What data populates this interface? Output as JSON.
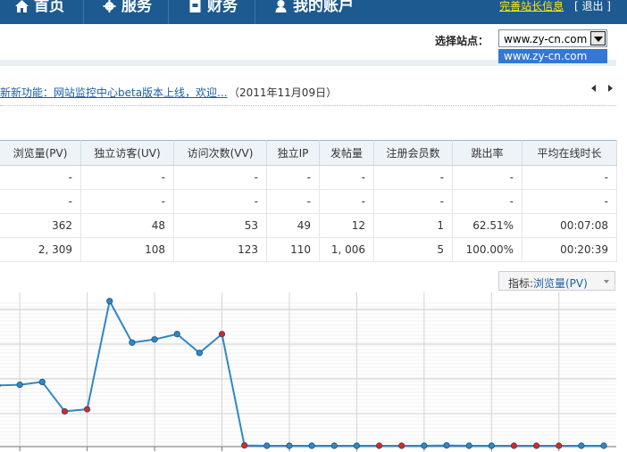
{
  "topbar": {
    "items": [
      {
        "label": "首页",
        "icon": "home-icon"
      },
      {
        "label": "服务",
        "icon": "gear-icon"
      },
      {
        "label": "财务",
        "icon": "wallet-icon"
      },
      {
        "label": "我的账户",
        "icon": "user-icon"
      }
    ],
    "complete_info": "完善站长信息",
    "logout": "[ 退出 ]"
  },
  "site_selector": {
    "label": "选择站点：",
    "value": "www.zy-cn.com",
    "option": "www.zy-cn.com"
  },
  "news": {
    "text": "新新功能：网站监控中心beta版本上线，欢迎...",
    "date": "（2011年11月09日）"
  },
  "stats_table": {
    "headers": [
      "浏览量(PV)",
      "独立访客(UV)",
      "访问次数(VV)",
      "独立IP",
      "发帖量",
      "注册会员数",
      "跳出率",
      "平均在线时长"
    ],
    "rows": [
      [
        "-",
        "-",
        "-",
        "-",
        "-",
        "-",
        "-",
        "-"
      ],
      [
        "-",
        "-",
        "-",
        "-",
        "-",
        "-",
        "-",
        "-"
      ],
      [
        "362",
        "48",
        "53",
        "49",
        "12",
        "1",
        "62.51%",
        "00:07:08"
      ],
      [
        "2, 309",
        "108",
        "123",
        "110",
        "1, 006",
        "5",
        "100.00%",
        "00:20:39"
      ]
    ]
  },
  "metric_selector": {
    "label": "指标:",
    "value": "浏览量(PV)"
  },
  "chart_data": {
    "type": "line",
    "series": [
      {
        "values": [
          170,
          172,
          180,
          97,
          103,
          408,
          291,
          300,
          315,
          262,
          315,
          1,
          0,
          0,
          0,
          0,
          0,
          0,
          0,
          0,
          1,
          0,
          0,
          0,
          0,
          0,
          0,
          0
        ],
        "marker_colors": [
          "blue",
          "blue",
          "blue",
          "red",
          "red",
          "blue",
          "blue",
          "blue",
          "blue",
          "blue",
          "red",
          "red",
          "blue",
          "blue",
          "blue",
          "blue",
          "blue",
          "red",
          "red",
          "blue",
          "blue",
          "blue",
          "blue",
          "red",
          "red",
          "red",
          "blue",
          "blue"
        ]
      }
    ],
    "ylim": [
      0,
      420
    ],
    "grid": true,
    "colors": {
      "line": "#2f88c6",
      "marker_blue": "#2f88c6",
      "marker_red": "#e02424"
    }
  }
}
